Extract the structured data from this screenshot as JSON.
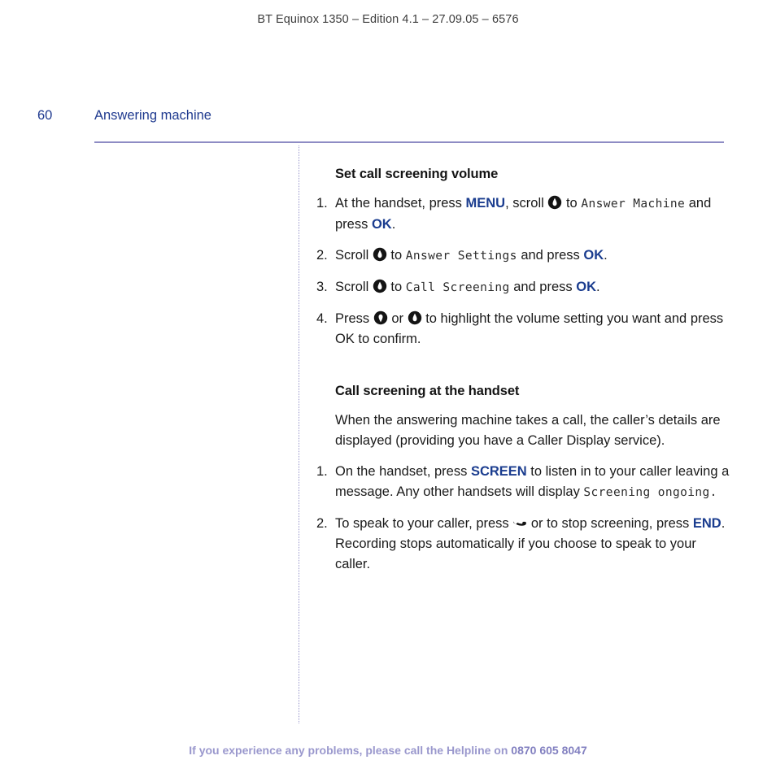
{
  "running_head": "BT Equinox 1350 – Edition 4.1 – 27.09.05 – 6576",
  "page": {
    "number": "60",
    "chapter": "Answering machine"
  },
  "colors": {
    "heading_blue": "#1f3a8f",
    "keyword_blue": "#1b3d8f",
    "rule_purple": "#8e8cc4",
    "footer_purple": "#9a98cd",
    "body_text": "#1a1a1a"
  },
  "sections": [
    {
      "heading": "Set call screening volume",
      "steps": [
        {
          "number": "1.",
          "parts": [
            {
              "type": "text",
              "value": "At the handset, press "
            },
            {
              "type": "key",
              "value": "MENU"
            },
            {
              "type": "text",
              "value": ", scroll "
            },
            {
              "type": "icon",
              "value": "scroll-up-icon"
            },
            {
              "type": "text",
              "value": " to "
            },
            {
              "type": "lcd",
              "value": "Answer Machine"
            },
            {
              "type": "text",
              "value": " and press "
            },
            {
              "type": "key",
              "value": "OK"
            },
            {
              "type": "text",
              "value": "."
            }
          ]
        },
        {
          "number": "2.",
          "parts": [
            {
              "type": "text",
              "value": "Scroll "
            },
            {
              "type": "icon",
              "value": "scroll-up-icon"
            },
            {
              "type": "text",
              "value": " to "
            },
            {
              "type": "lcd",
              "value": "Answer Settings"
            },
            {
              "type": "text",
              "value": " and press "
            },
            {
              "type": "key",
              "value": "OK"
            },
            {
              "type": "text",
              "value": "."
            }
          ]
        },
        {
          "number": "3.",
          "parts": [
            {
              "type": "text",
              "value": "Scroll "
            },
            {
              "type": "icon",
              "value": "scroll-up-icon"
            },
            {
              "type": "text",
              "value": " to "
            },
            {
              "type": "lcd",
              "value": "Call Screening"
            },
            {
              "type": "text",
              "value": " and press "
            },
            {
              "type": "key",
              "value": "OK"
            },
            {
              "type": "text",
              "value": "."
            }
          ]
        },
        {
          "number": "4.",
          "parts": [
            {
              "type": "text",
              "value": "Press "
            },
            {
              "type": "icon",
              "value": "scroll-down-icon"
            },
            {
              "type": "text",
              "value": " or "
            },
            {
              "type": "icon",
              "value": "scroll-up-icon"
            },
            {
              "type": "text",
              "value": " to highlight the volume setting you want and press OK to confirm."
            }
          ]
        }
      ]
    },
    {
      "heading": "Call screening at the handset",
      "paragraph": "When the answering machine takes a call, the caller’s details are displayed (providing you have a Caller Display service).",
      "steps": [
        {
          "number": "1.",
          "parts": [
            {
              "type": "text",
              "value": "On the handset, press "
            },
            {
              "type": "key",
              "value": "SCREEN"
            },
            {
              "type": "text",
              "value": " to listen in to your caller leaving a message. Any other handsets will display "
            },
            {
              "type": "lcd",
              "value": "Screening ongoing."
            }
          ]
        },
        {
          "number": "2.",
          "parts": [
            {
              "type": "text",
              "value": "To speak to your caller, press "
            },
            {
              "type": "icon",
              "value": "phone-handset-icon"
            },
            {
              "type": "text",
              "value": " or to stop screening, press "
            },
            {
              "type": "key",
              "value": "END"
            },
            {
              "type": "text",
              "value": ". Recording stops automatically if you choose to speak to your caller."
            }
          ]
        }
      ]
    }
  ],
  "footer": {
    "text": "If you experience any problems, please call the Helpline on ",
    "phone": "0870 605 8047"
  }
}
